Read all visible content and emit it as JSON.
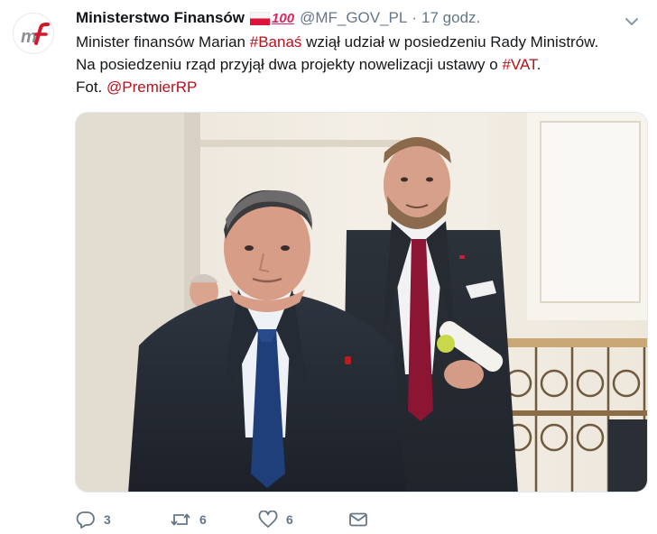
{
  "tweet": {
    "author_name": "Ministerstwo Finansów",
    "badge_text": "100",
    "handle": "@MF_GOV_PL",
    "separator": "·",
    "time": "17 godz.",
    "text": {
      "l1_a": "Minister finansów Marian ",
      "l1_tag": "#Banaś",
      "l1_b": " wziął udział w posiedzeniu Rady Ministrów.",
      "l2_a": "Na posiedzeniu rząd przyjął dwa projekty nowelizacji ustawy o ",
      "l2_tag": "#VAT",
      "l2_b": ".",
      "l3_a": "Fot. ",
      "l3_mention": "@PremierRP"
    }
  },
  "actions": {
    "reply_count": "3",
    "retweet_count": "6",
    "like_count": "6"
  },
  "icons": {
    "avatar": "mf-logo-icon",
    "flag": "poland-flag-icon",
    "hundred": "hundred-points-icon",
    "caret": "chevron-down-icon",
    "reply": "reply-icon",
    "retweet": "retweet-icon",
    "like": "heart-icon",
    "dm": "envelope-icon"
  },
  "colors": {
    "link": "#b5121b",
    "muted": "#657786",
    "text": "#14171a"
  }
}
